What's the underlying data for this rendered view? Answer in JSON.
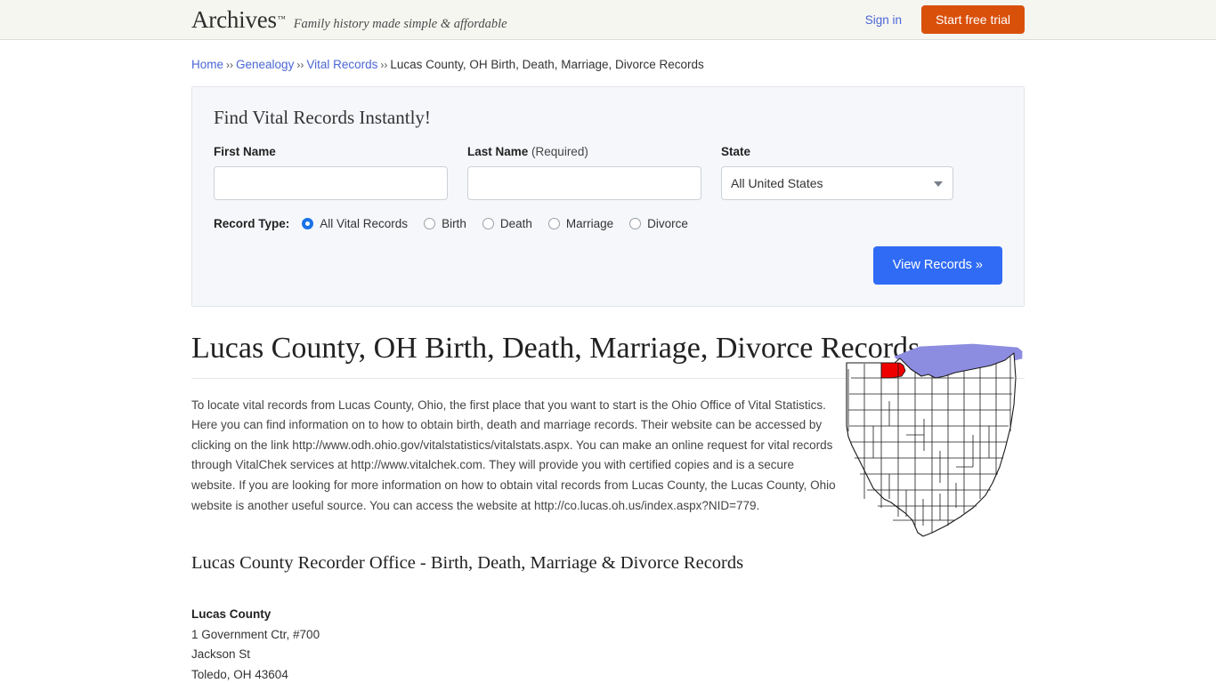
{
  "header": {
    "logo": "Archives",
    "logo_tm": "™",
    "tagline": "Family history made simple & affordable",
    "sign_in": "Sign in",
    "start_trial": "Start free trial",
    "trial_color": "#d9500b"
  },
  "breadcrumb": {
    "items": [
      {
        "label": "Home",
        "link": true
      },
      {
        "label": "Genealogy",
        "link": true
      },
      {
        "label": "Vital Records",
        "link": true
      },
      {
        "label": "Lucas County, OH Birth, Death, Marriage, Divorce Records",
        "link": false
      }
    ],
    "separator": "››"
  },
  "search": {
    "title": "Find Vital Records Instantly!",
    "first_name_label": "First Name",
    "first_name_value": "",
    "first_name_placeholder": "",
    "last_name_label": "Last Name",
    "last_name_required": "(Required)",
    "last_name_value": "",
    "last_name_placeholder": "",
    "state_label": "State",
    "state_value": "All United States",
    "record_type_label": "Record Type:",
    "record_types": [
      {
        "label": "All Vital Records",
        "selected": true
      },
      {
        "label": "Birth",
        "selected": false
      },
      {
        "label": "Death",
        "selected": false
      },
      {
        "label": "Marriage",
        "selected": false
      },
      {
        "label": "Divorce",
        "selected": false
      }
    ],
    "submit_label": "View Records »",
    "submit_color": "#2f6bf5"
  },
  "article": {
    "title": "Lucas County, OH Birth, Death, Marriage, Divorce Records",
    "paragraph": "To locate vital records from Lucas County, Ohio, the first place that you want to start is the Ohio Office of Vital Statistics. Here you can find information on to how to obtain birth, death and marriage records. Their website can be accessed by clicking on the link http://www.odh.ohio.gov/vitalstatistics/vitalstats.aspx. You can make an online request for vital records through VitalChek services at http://www.vitalchek.com. They will provide you with certified copies and is a secure website. If you are looking for more information on how to obtain vital records from Lucas County, the Lucas County, Ohio website is another useful source. You can access the website at http://co.lucas.oh.us/index.aspx?NID=779.",
    "subtitle": "Lucas County Recorder Office - Birth, Death, Marriage & Divorce Records",
    "address": {
      "name": "Lucas County",
      "line1": "1 Government Ctr, #700",
      "line2": "Jackson St",
      "line3": "Toledo, OH 43604"
    }
  },
  "map": {
    "alt": "Map of Ohio counties with Lucas County highlighted",
    "state": "Ohio",
    "highlighted_county": "Lucas County",
    "highlight_color": "#ee0000",
    "lake_color": "#8c8ce0",
    "outline_color": "#1a1a1a"
  }
}
